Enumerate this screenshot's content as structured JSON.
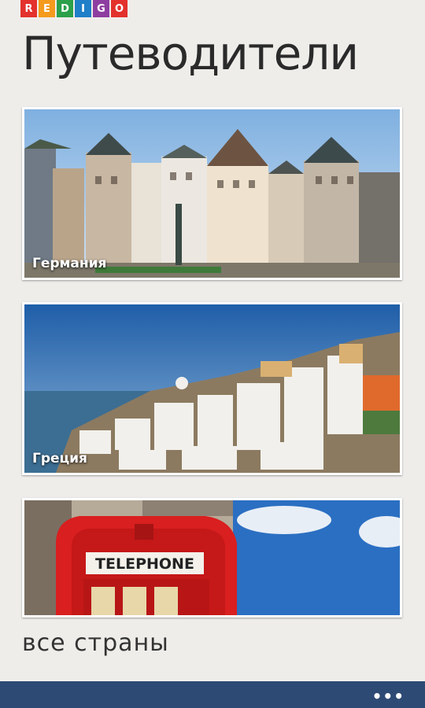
{
  "app": {
    "logo_letters": [
      "R",
      "E",
      "D",
      "I",
      "G",
      "O"
    ],
    "logo_colors": [
      "#e3312d",
      "#f49b1d",
      "#2ca04a",
      "#1f7fc8",
      "#8e3ea0",
      "#e3312d"
    ]
  },
  "page": {
    "title": "Путеводители",
    "all_countries": "все страны"
  },
  "cards": [
    {
      "label": "Германия",
      "image": "frankfurt-roemerberg-photo"
    },
    {
      "label": "Греция",
      "image": "santorini-photo"
    },
    {
      "label": "",
      "image": "london-telephone-box-photo"
    }
  ],
  "appbar": {
    "more_icon": "ellipsis-icon",
    "more_label": "•••"
  }
}
